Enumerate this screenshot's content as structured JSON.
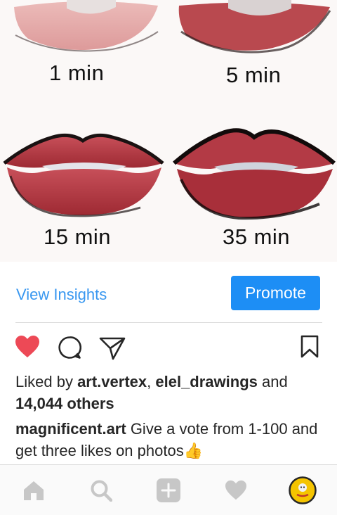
{
  "post": {
    "captions": [
      "1 min",
      "5 min",
      "15 min",
      "35 min"
    ]
  },
  "insights": {
    "view_label": "View Insights",
    "promote_label": "Promote"
  },
  "likes": {
    "prefix": "Liked by ",
    "user1": "art.vertex",
    "sep": ", ",
    "user2": "elel_drawings",
    "and": " and",
    "count": "14,044 others"
  },
  "caption": {
    "username": "magnificent.art",
    "text": " Give a vote from 1-100 and get three likes on photos",
    "emoji": "👍"
  },
  "icons": {
    "like": "heart-filled-icon",
    "comment": "comment-bubble-icon",
    "share": "paper-plane-icon",
    "save": "bookmark-icon",
    "nav": [
      "home-icon",
      "search-icon",
      "add-icon",
      "activity-heart-icon",
      "profile-avatar-icon"
    ]
  },
  "colors": {
    "accent": "#3897f0",
    "promote_bg": "#1d8ef5",
    "like_red": "#ed4956",
    "nav_icon": "#c7c7c7"
  }
}
